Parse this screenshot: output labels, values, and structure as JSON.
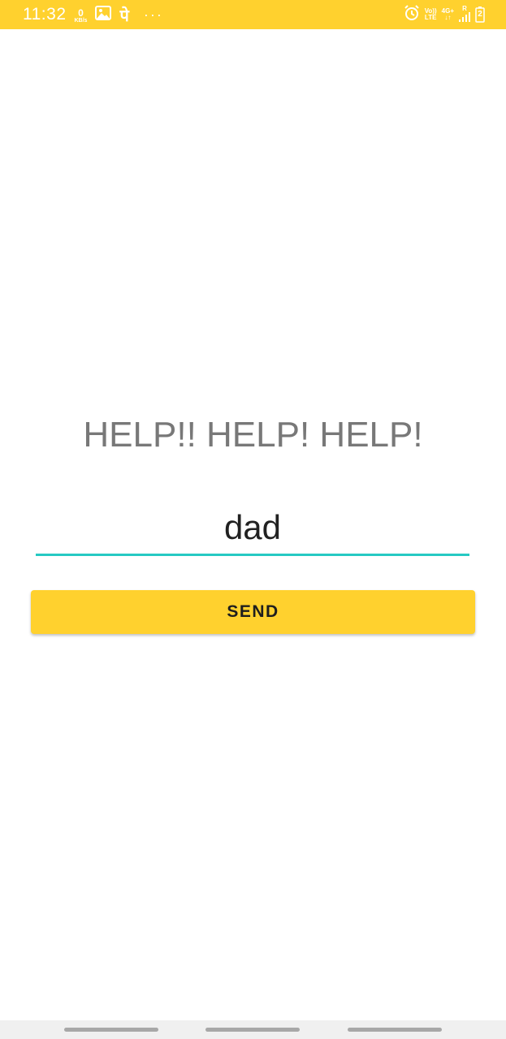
{
  "status_bar": {
    "time": "11:32",
    "net_speed_value": "0",
    "net_speed_unit": "KB/s",
    "notification_glyph": "पे",
    "more_dots": "···",
    "volte_top": "Vo))",
    "volte_bottom": "LTE",
    "network_type": "4G+",
    "roaming": "R",
    "battery_level": "2",
    "background_color": "#ffd12e"
  },
  "main": {
    "help_text": "HELP!! HELP! HELP!",
    "contact_value": "dad",
    "contact_underline_color": "#26c9c3",
    "send_label": "SEND",
    "send_color": "#ffd12e"
  }
}
